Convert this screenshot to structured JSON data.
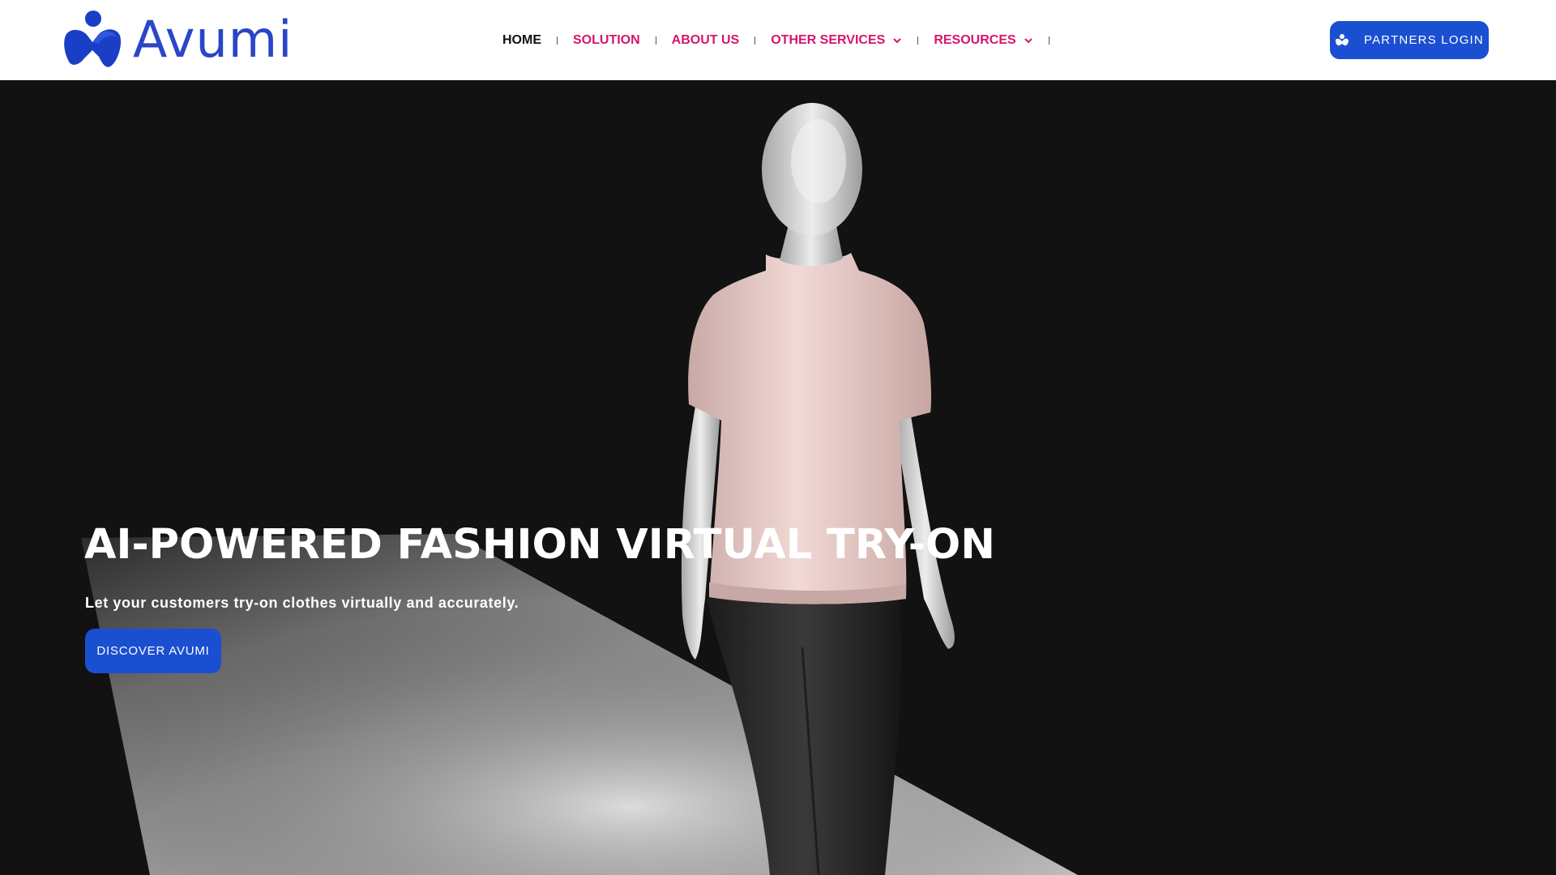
{
  "brand": {
    "name": "Avumi",
    "color": "#2a46c8"
  },
  "nav": {
    "items": [
      {
        "label": "HOME",
        "active": true
      },
      {
        "label": "SOLUTION"
      },
      {
        "label": "ABOUT US"
      },
      {
        "label": "OTHER SERVICES",
        "dropdown": true
      },
      {
        "label": "RESOURCES",
        "dropdown": true
      }
    ],
    "accent_color": "#d6156b"
  },
  "header": {
    "login_label": "PARTNERS LOGIN",
    "login_icon": "user-icon"
  },
  "hero": {
    "title": "AI-POWERED FASHION VIRTUAL TRY-ON",
    "subtitle": "Let your customers try-on clothes virtually and accurately.",
    "cta_label": "DISCOVER AVUMI",
    "button_color": "#1a4fd1"
  }
}
